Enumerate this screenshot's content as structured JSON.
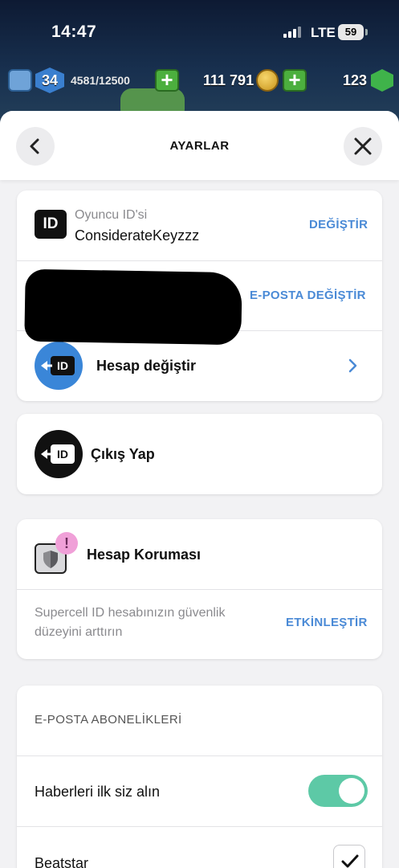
{
  "status_bar": {
    "time": "14:47",
    "network": "LTE",
    "battery": "59"
  },
  "hud": {
    "level": "34",
    "xp": "4581/12500",
    "gold": "111 791",
    "gems": "123"
  },
  "header": {
    "title": "AYARLAR",
    "back_icon": "chevron-left-icon",
    "close_icon": "close-icon"
  },
  "account_card": {
    "player_id_label": "Oyuncu ID'si",
    "player_id_value": "ConsiderateKeyzzz",
    "change_id_link": "DEĞİŞTİR",
    "change_email_link": "E-POSTA DEĞİŞTİR",
    "switch_account_label": "Hesap değiştir",
    "id_badge_text": "ID"
  },
  "logout_card": {
    "label": "Çıkış Yap",
    "id_badge_text": "ID"
  },
  "protection_card": {
    "title": "Hesap Koruması",
    "alert_badge": "!",
    "description_line1": "Supercell ID hesabınızın güvenlik",
    "description_line2": "düzeyini arttırın",
    "enable_link": "ETKİNLEŞTİR"
  },
  "subscriptions_card": {
    "section_title": "E-POSTA ABONELİKLERİ",
    "items": [
      {
        "label": "Haberleri ilk siz alın",
        "control": "toggle",
        "state": "on"
      },
      {
        "label": "Beatstar",
        "control": "checkbox",
        "state": "checked"
      }
    ]
  },
  "colors": {
    "accent_link": "#4a8ad6",
    "toggle_on": "#5dc9a6",
    "switch_account_icon": "#3a86d8",
    "alert_badge": "#f0a0d8"
  }
}
